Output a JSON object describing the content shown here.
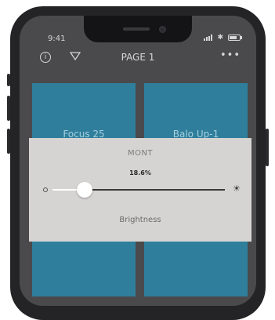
{
  "status_bar": {
    "time": "9:41",
    "signal_icon": "signal-icon",
    "wifi_icon": "bluetooth-icon",
    "battery_icon": "battery-icon"
  },
  "header": {
    "title": "PAGE 1",
    "info_icon": "info-icon",
    "filter_icon": "filter-icon",
    "more_icon": "more-icon"
  },
  "tiles": [
    {
      "label": "Focus 25"
    },
    {
      "label": "Balo Up-1"
    },
    {
      "label": ""
    },
    {
      "label": ""
    }
  ],
  "dialog": {
    "title": "MONT",
    "value_text": "18.6%",
    "value": 0.186,
    "label": "Brightness",
    "min_icon": "brightness-low-icon",
    "max_icon": "brightness-high-icon"
  },
  "colors": {
    "tile": "#2f7f9c",
    "dialog_bg": "#d6d4d3",
    "screen_bg": "#4a4a4c"
  }
}
